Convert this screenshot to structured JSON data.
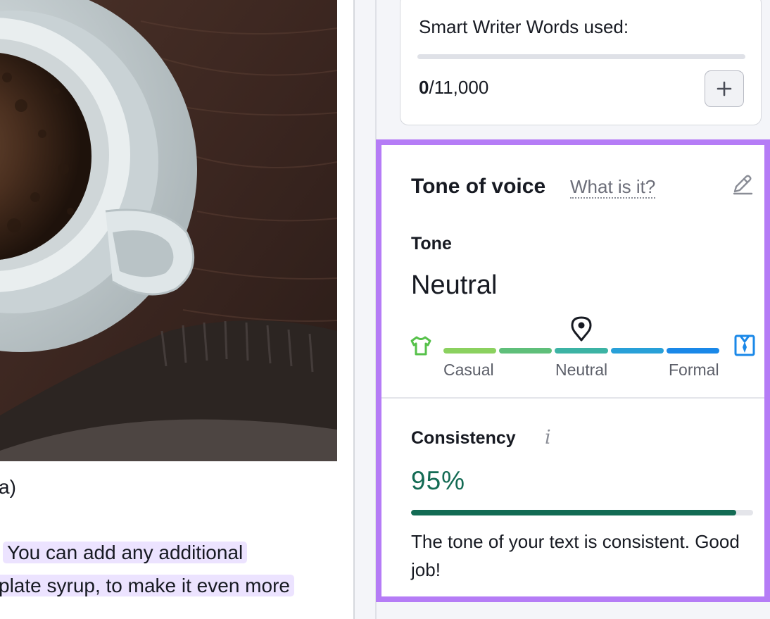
{
  "editor": {
    "line1": "a)",
    "line2": "You can add any additional",
    "line3": "plate syrup, to make it even more"
  },
  "usage": {
    "title": "Smart Writer Words used:",
    "used": "0",
    "limit": "/11,000",
    "add_icon": "plus-icon"
  },
  "tone_panel": {
    "heading": "Tone of voice",
    "help_link": "What is it?",
    "edit_icon": "pencil-icon",
    "tone_label": "Tone",
    "tone_value": "Neutral",
    "tone_position": 0.5,
    "scale": [
      "Casual",
      "Neutral",
      "Formal"
    ],
    "scale_colors": [
      "#8bd15f",
      "#5fbf7a",
      "#3cb3a4",
      "#28a0d8",
      "#1a88e8"
    ],
    "left_icon": "tshirt-icon",
    "right_icon": "shirt-tie-icon",
    "marker_icon": "location-pin-icon",
    "consistency_label": "Consistency",
    "consistency_info_icon": "info-icon",
    "consistency_value": "95%",
    "consistency_fraction": 0.95,
    "consistency_message": "The tone of your text is consistent. Good job!",
    "accent_border": "#b57cf6",
    "consistency_color": "#136b54"
  }
}
